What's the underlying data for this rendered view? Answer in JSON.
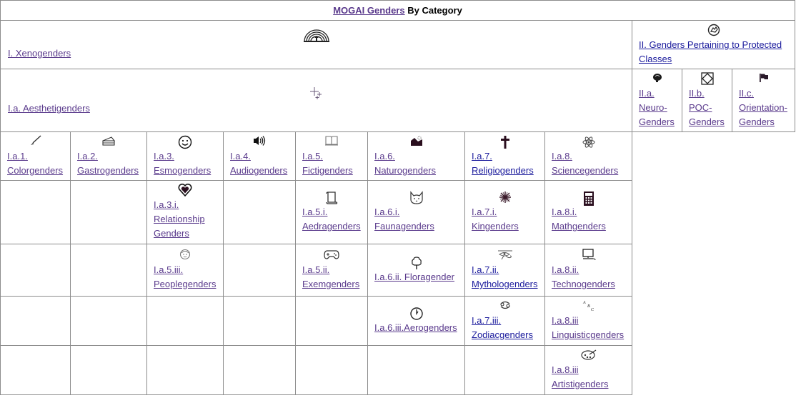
{
  "header": {
    "link": "MOGAI Genders",
    "suffix": " By Category"
  },
  "xeno": {
    "icon": "rainbow-icon",
    "glyph": "⌒",
    "label": "I. Xenogenders"
  },
  "protected": {
    "icon": "fist-icon",
    "glyph": "✊",
    "label": "II. Genders Pertaining to Protected Classes"
  },
  "aesthetic": {
    "icon": "sparkles-icon",
    "glyph": "✧",
    "label": "I.a. Aesthetigenders"
  },
  "protected_sub": [
    {
      "icon": "brain-icon",
      "glyph": "●",
      "code": "II.a.",
      "name": "Neuro-",
      "name2": "Genders"
    },
    {
      "icon": "diamond-icon",
      "glyph": "◇",
      "code": "II.b.",
      "name": "POC-",
      "name2": "Genders"
    },
    {
      "icon": "flag-icon",
      "glyph": "⚑",
      "code": "II.c.",
      "name": "Orientation-",
      "name2": "Genders"
    }
  ],
  "row1": [
    {
      "icon": "paintbrush-icon",
      "glyph": "🖌",
      "code": "I.a.1.",
      "name": "Colorgenders"
    },
    {
      "icon": "cake-icon",
      "glyph": "🍰",
      "code": "I.a.2.",
      "name": "Gastrogenders"
    },
    {
      "icon": "smiley-icon",
      "glyph": "☺",
      "code": "I.a.3.",
      "name": "Esmogenders"
    },
    {
      "icon": "speaker-icon",
      "glyph": "🔊",
      "code": "I.a.4.",
      "name": "Audiogenders"
    },
    {
      "icon": "book-icon",
      "glyph": "📖",
      "code": "I.a.5.",
      "name": "Fictigenders"
    },
    {
      "icon": "mountain-icon",
      "glyph": "⛰",
      "code": "I.a.6.",
      "name": "Naturogenders"
    },
    {
      "icon": "cross-icon",
      "glyph": "✝",
      "code": "I.a.7.",
      "name": "Religiogenders"
    },
    {
      "icon": "atom-icon",
      "glyph": "⚛",
      "code": "I.a.8.",
      "name": "Sciencegenders"
    }
  ],
  "row2": {
    "relationship": {
      "icon": "heart-icon",
      "glyph": "♥",
      "code": "I.a.3.i.",
      "name": "Relationship",
      "name2": "Genders"
    },
    "aedra": {
      "icon": "scroll-icon",
      "glyph": "📜",
      "code": "I.a.5.i.",
      "name": "Aedragenders"
    },
    "fauna": {
      "icon": "cat-icon",
      "glyph": "🐱",
      "code": "I.a.6.i.",
      "name": "Faunagenders"
    },
    "kin": {
      "icon": "star-burst-icon",
      "glyph": "✳",
      "code": "I.a.7.i.",
      "name": "Kingenders"
    },
    "math": {
      "icon": "calculator-icon",
      "glyph": "▦",
      "code": "I.a.8.i.",
      "name": "Mathgenders"
    }
  },
  "row3": {
    "people": {
      "icon": "face-icon",
      "glyph": "☻",
      "code": "I.a.5.iii.",
      "name": "Peoplegenders"
    },
    "exem": {
      "icon": "gamepad-icon",
      "glyph": "🎮",
      "code": "I.a.5.ii.",
      "name": "Exemgenders"
    },
    "flora": {
      "icon": "tree-icon",
      "glyph": "🌳",
      "label": "I.a.6.ii. Floragender"
    },
    "mytho": {
      "icon": "eye-of-horus-icon",
      "glyph": "𓂀",
      "code": "I.a.7.ii.",
      "name": "Mythologenders"
    },
    "techno": {
      "icon": "computer-icon",
      "glyph": "🖳",
      "code": "I.a.8.ii.",
      "name": "Technogenders"
    }
  },
  "row4": {
    "aero": {
      "icon": "clock-icon",
      "glyph": "🕐",
      "label": "I.a.6.iii.Aerogenders"
    },
    "zodiac": {
      "icon": "cancer-sign-icon",
      "glyph": "♋",
      "code": "I.a.7.iii.",
      "name": "Zodiacgenders"
    },
    "linguistic": {
      "icon": "abc-icon",
      "glyph": "ᴬᴮᶜ",
      "code": "I.a.8.iii",
      "name": "Linguisticgenders"
    }
  },
  "row5": {
    "artisti": {
      "icon": "palette-icon",
      "glyph": "🎨",
      "code": "I.a.8.iii",
      "name": "Artistigenders"
    }
  }
}
